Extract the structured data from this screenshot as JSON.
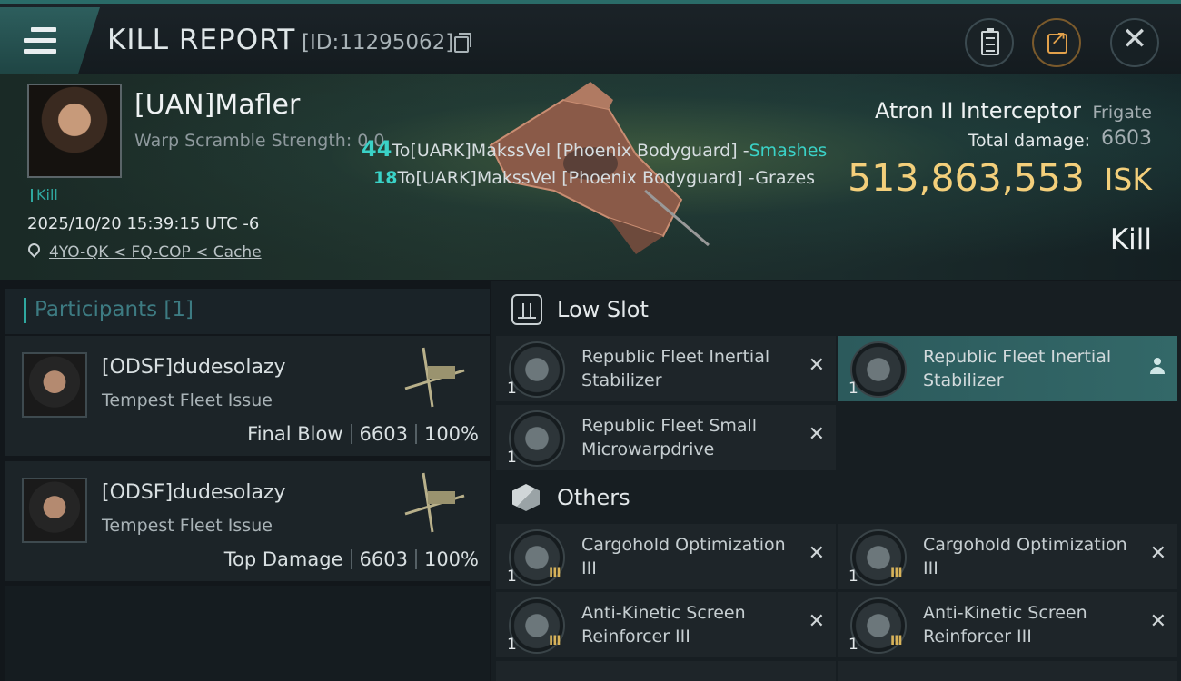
{
  "topbar": {
    "title": "KILL REPORT",
    "report_id": "[ID:11295062]"
  },
  "victim": {
    "name": "[UAN]Mafler",
    "warp_scramble": "Warp Scramble Strength: 0.0",
    "kill_tag": "Kill",
    "datetime": "2025/10/20 15:39:15 UTC -6",
    "location": "4YO-QK < FQ-COP < Cache",
    "ship_name": "Atron II Interceptor",
    "ship_class": "Frigate",
    "total_damage_label": "Total damage:",
    "total_damage": "6603",
    "isk_value": "513,863,553",
    "isk_unit": "ISK",
    "outcome": "Kill"
  },
  "damage_log": [
    {
      "amount": "44",
      "text": "To[UARK]MakssVel [Phoenix Bodyguard] -",
      "result": "Smashes"
    },
    {
      "amount": "18",
      "text": "To[UARK]MakssVel [Phoenix Bodyguard] -Grazes"
    }
  ],
  "participants": {
    "header": "Participants [1]",
    "items": [
      {
        "name": "[ODSF]dudesolazy",
        "ship": "Tempest Fleet Issue",
        "role": "Final Blow",
        "damage": "6603",
        "percent": "100%"
      },
      {
        "name": "[ODSF]dudesolazy",
        "ship": "Tempest Fleet Issue",
        "role": "Top Damage",
        "damage": "6603",
        "percent": "100%"
      }
    ]
  },
  "sections": {
    "low_slot": "Low Slot",
    "others": "Others"
  },
  "modules": [
    {
      "name": "Republic Fleet Inertial Stabilizer",
      "qty": "1"
    },
    {
      "name": "Republic Fleet Inertial Stabilizer",
      "qty": "1"
    },
    {
      "name": "Republic Fleet Small Microwarpdrive",
      "qty": "1"
    },
    {
      "name": "Cargohold Optimization III",
      "qty": "1",
      "meta": "III"
    },
    {
      "name": "Cargohold Optimization III",
      "qty": "1",
      "meta": "III"
    },
    {
      "name": "Anti-Kinetic Screen Reinforcer III",
      "qty": "1",
      "meta": "III"
    },
    {
      "name": "Anti-Kinetic Screen Reinforcer III",
      "qty": "1",
      "meta": "III"
    }
  ],
  "colors": {
    "accent": "#2fa8a0",
    "isk_gold": "#f3cf7b",
    "smash_teal": "#3ad2c7"
  }
}
